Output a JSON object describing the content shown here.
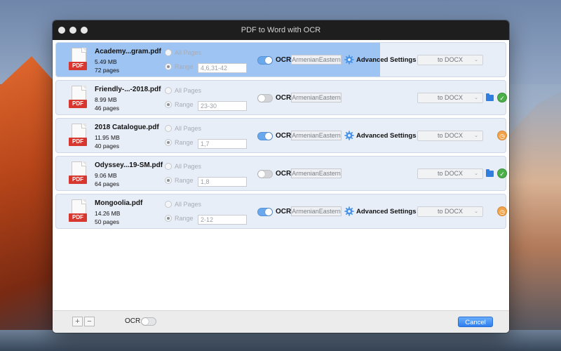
{
  "window": {
    "title": "PDF to Word with OCR"
  },
  "files": [
    {
      "name": "Academy...gram.pdf",
      "size": "5.49 MB",
      "pages": "72 pages",
      "icon_label": "PDF",
      "all_pages_label": "All Pages",
      "range_label": "Range",
      "range_value": "4,6,31-42",
      "ocr_on": true,
      "ocr_label": "OCR",
      "language": "ArmenianEastern",
      "advanced_label": "Advanced Settings",
      "format": "to DOCX",
      "progress": 0.72,
      "status": "converting"
    },
    {
      "name": "Friendly-...-2018.pdf",
      "size": "8.99 MB",
      "pages": "46 pages",
      "icon_label": "PDF",
      "all_pages_label": "All Pages",
      "range_label": "Range",
      "range_value": "23-30",
      "ocr_on": false,
      "ocr_label": "OCR",
      "language": "ArmenianEastern",
      "advanced_label": "",
      "format": "to DOCX",
      "progress": 0,
      "status": "done"
    },
    {
      "name": "2018 Catalogue.pdf",
      "size": "11.95 MB",
      "pages": "40 pages",
      "icon_label": "PDF",
      "all_pages_label": "All Pages",
      "range_label": "Range",
      "range_value": "1,7",
      "ocr_on": true,
      "ocr_label": "OCR",
      "language": "ArmenianEastern",
      "advanced_label": "Advanced Settings",
      "format": "to DOCX",
      "progress": 0,
      "status": "waiting"
    },
    {
      "name": "Odyssey...19-SM.pdf",
      "size": "9.06 MB",
      "pages": "64 pages",
      "icon_label": "PDF",
      "all_pages_label": "All Pages",
      "range_label": "Range",
      "range_value": "1,8",
      "ocr_on": false,
      "ocr_label": "OCR",
      "language": "ArmenianEastern",
      "advanced_label": "",
      "format": "to DOCX",
      "progress": 0,
      "status": "done"
    },
    {
      "name": "Mongoolia.pdf",
      "size": "14.26 MB",
      "pages": "50 pages",
      "icon_label": "PDF",
      "all_pages_label": "All Pages",
      "range_label": "Range",
      "range_value": "2-12",
      "ocr_on": true,
      "ocr_label": "OCR",
      "language": "ArmenianEastern",
      "advanced_label": "Advanced Settings",
      "format": "to DOCX",
      "progress": 0,
      "status": "waiting"
    }
  ],
  "bottom": {
    "add_label": "+",
    "remove_label": "−",
    "ocr_label": "OCR",
    "ocr_on": false,
    "cancel_label": "Cancel"
  },
  "colors": {
    "accent": "#2e7ef0",
    "progress": "#9ec4f3",
    "done": "#4cb04a",
    "waiting": "#f0a348",
    "pdf_red": "#d6372f"
  }
}
